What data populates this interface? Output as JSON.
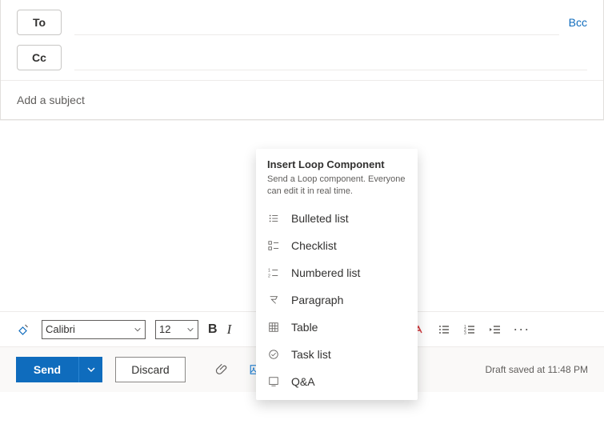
{
  "recipients": {
    "to_label": "To",
    "cc_label": "Cc",
    "bcc_label": "Bcc"
  },
  "subject": {
    "placeholder": "Add a subject",
    "value": ""
  },
  "format": {
    "font_name": "Calibri",
    "font_size": "12"
  },
  "loop_popup": {
    "title": "Insert Loop Component",
    "subtitle": "Send a Loop component. Everyone can edit it in real time.",
    "items": [
      {
        "label": "Bulleted list"
      },
      {
        "label": "Checklist"
      },
      {
        "label": "Numbered list"
      },
      {
        "label": "Paragraph"
      },
      {
        "label": "Table"
      },
      {
        "label": "Task list"
      },
      {
        "label": "Q&A"
      }
    ]
  },
  "actions": {
    "send_label": "Send",
    "discard_label": "Discard"
  },
  "status": {
    "draft_saved": "Draft saved at 11:48 PM"
  }
}
